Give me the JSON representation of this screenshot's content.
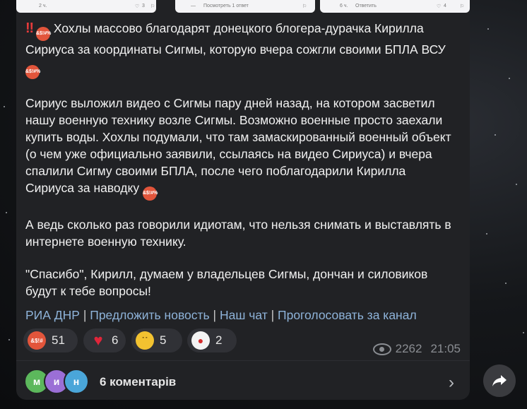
{
  "thumbs": [
    {
      "time": "2 ч.",
      "likes": "3"
    },
    {
      "caption": "Посмотреть 1 ответ"
    },
    {
      "time": "6 ч.",
      "reply": "Ответить",
      "likes": "4"
    }
  ],
  "post": {
    "paragraphs": [
      "Хохлы массово благодарят донецкого блогера-дурачка Кирилла Сириуса за координаты Сигмы, которую вчера сожгли своими БПЛА ВСУ",
      "Сириус выложил видео с Сигмы пару дней назад, на котором засветил нашу военную технику возле Сигмы. Возможно военные просто заехали купить воды. Хохлы подумали, что там замаскированный военный объект (о чем уже официально заявили, ссылаясь на видео Сириуса) и вчера спалили Сигму своими БПЛА, после чего поблагодарили Кирилла Сириуса за наводку",
      "А ведь сколько раз говорили идиотам, что нельзя снимать и выставлять в интернете военную технику.",
      "\"Спасибо\", Кирилл, думаем у владельцев Сигмы, дончан и силовиков будут к тебе вопросы!"
    ],
    "links": [
      "РИА ДНР",
      "Предложить новость",
      "Наш чат",
      "Проголосовать за канал"
    ],
    "link_separator": "|"
  },
  "reactions": [
    {
      "icon": "angry-face-icon",
      "count": "51"
    },
    {
      "icon": "heart-icon",
      "count": "6"
    },
    {
      "icon": "neutral-face-icon",
      "count": "5"
    },
    {
      "icon": "clown-face-icon",
      "count": "2"
    }
  ],
  "meta": {
    "views": "2262",
    "time": "21:05"
  },
  "comments": {
    "avatars": [
      {
        "letter": "м",
        "color": "#5cb85c"
      },
      {
        "letter": "и",
        "color": "#9b6fd6"
      },
      {
        "letter": "н",
        "color": "#4aa6d9"
      }
    ],
    "label": "6 коментарів"
  },
  "colors": {
    "link": "#8eb3d9",
    "bubble": "#212225"
  }
}
